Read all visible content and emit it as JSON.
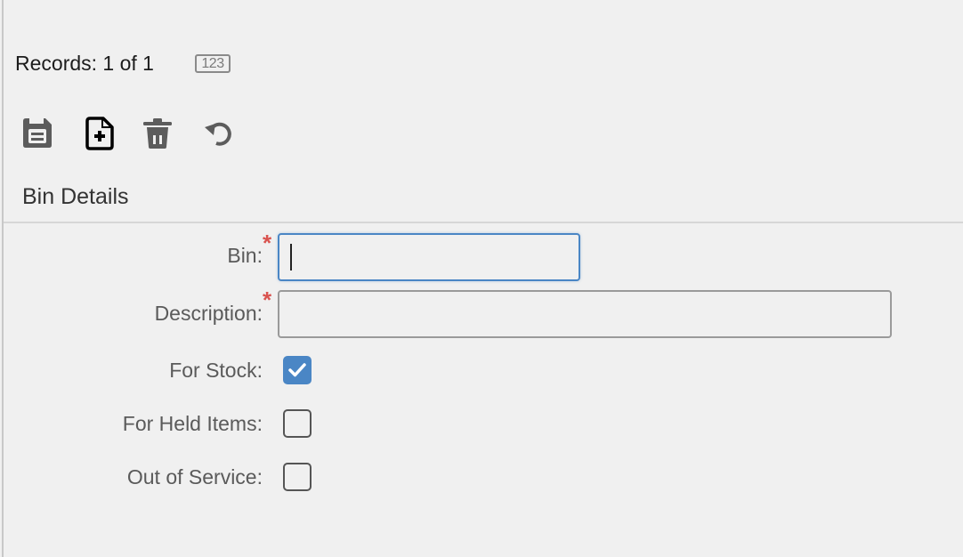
{
  "records": {
    "label": "Records: 1 of 1",
    "badge": "123"
  },
  "toolbar": {
    "buttons": [
      {
        "name": "save",
        "icon": "save-icon"
      },
      {
        "name": "new",
        "icon": "new-document-icon"
      },
      {
        "name": "delete",
        "icon": "trash-icon"
      },
      {
        "name": "undo",
        "icon": "undo-icon"
      }
    ]
  },
  "section": {
    "title": "Bin Details"
  },
  "form": {
    "bin": {
      "label": "Bin:",
      "required": "*",
      "value": ""
    },
    "description": {
      "label": "Description:",
      "required": "*",
      "value": ""
    },
    "for_stock": {
      "label": "For Stock:",
      "checked": true
    },
    "for_held_items": {
      "label": "For Held Items:",
      "checked": false
    },
    "out_of_service": {
      "label": "Out of Service:",
      "checked": false
    }
  },
  "colors": {
    "accent": "#4a86c5",
    "required": "#d9534f"
  }
}
